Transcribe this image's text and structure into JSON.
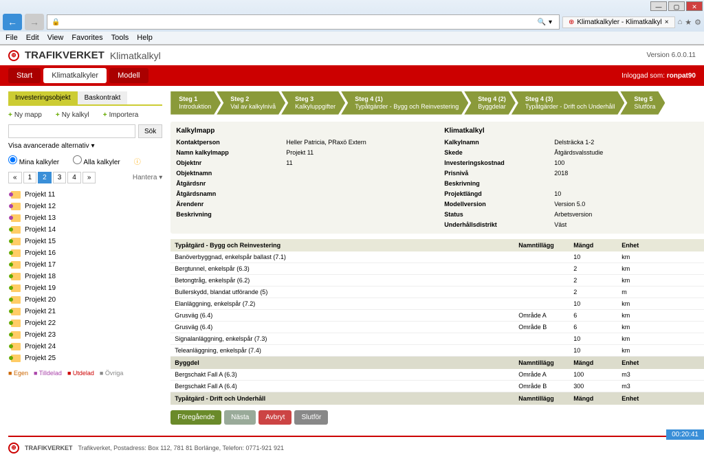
{
  "browser": {
    "tab_title": "Klimatkalkyler - Klimatkalkyl",
    "search_hint": "",
    "zoom_icon": "🔍"
  },
  "menus": [
    "File",
    "Edit",
    "View",
    "Favorites",
    "Tools",
    "Help"
  ],
  "header": {
    "brand": "TRAFIKVERKET",
    "app": "Klimatkalkyl",
    "version": "Version 6.0.0.11",
    "login_prefix": "Inloggad som:",
    "login_user": "ronpat90"
  },
  "main_tabs": [
    {
      "label": "Start",
      "active": false
    },
    {
      "label": "Klimatkalkyler",
      "active": true
    },
    {
      "label": "Modell",
      "active": false
    }
  ],
  "sub_tabs": [
    {
      "label": "Investeringsobjekt",
      "active": true
    },
    {
      "label": "Baskontrakt",
      "active": false
    }
  ],
  "toolbar": {
    "new_folder": "Ny mapp",
    "new_calc": "Ny kalkyl",
    "import": "Importera"
  },
  "search": {
    "placeholder": "",
    "btn": "Sök",
    "advanced": "Visa avancerade alternativ"
  },
  "radios": {
    "mine": "Mina kalkyler",
    "all": "Alla kalkyler"
  },
  "pager": {
    "pages": [
      "«",
      "1",
      "2",
      "3",
      "4",
      "»"
    ],
    "active": "2",
    "hantera": "Hantera"
  },
  "projects": [
    {
      "name": "Projekt 11",
      "color": "purple"
    },
    {
      "name": "Projekt 12",
      "color": "purple"
    },
    {
      "name": "Projekt 13",
      "color": "purple"
    },
    {
      "name": "Projekt 14",
      "color": "green"
    },
    {
      "name": "Projekt 15",
      "color": "green"
    },
    {
      "name": "Projekt 16",
      "color": "green"
    },
    {
      "name": "Projekt 17",
      "color": "green"
    },
    {
      "name": "Projekt 18",
      "color": "green"
    },
    {
      "name": "Projekt 19",
      "color": "green"
    },
    {
      "name": "Projekt 20",
      "color": "green"
    },
    {
      "name": "Projekt 21",
      "color": "green"
    },
    {
      "name": "Projekt 22",
      "color": "green"
    },
    {
      "name": "Projekt 23",
      "color": "green"
    },
    {
      "name": "Projekt 24",
      "color": "green"
    },
    {
      "name": "Projekt 25",
      "color": "green"
    }
  ],
  "legend": {
    "egen": "Egen",
    "tilldelad": "Tilldelad",
    "utdelad": "Utdelad",
    "ovriga": "Övriga"
  },
  "steps": [
    {
      "t": "Steg 1",
      "s": "Introduktion"
    },
    {
      "t": "Steg 2",
      "s": "Val av kalkylnivå"
    },
    {
      "t": "Steg 3",
      "s": "Kalkyluppgifter"
    },
    {
      "t": "Steg 4 (1)",
      "s": "Typåtgärder - Bygg och Reinvestering"
    },
    {
      "t": "Steg 4 (2)",
      "s": "Byggdelar"
    },
    {
      "t": "Steg 4 (3)",
      "s": "Typåtgärder - Drift och Underhåll"
    },
    {
      "t": "Steg 5",
      "s": "Slutföra"
    }
  ],
  "info": {
    "h1": "Kalkylmapp",
    "h2": "Klimatkalkyl",
    "left_labels": [
      "Kontaktperson",
      "Namn kalkylmapp",
      "Objektnr",
      "Objektnamn",
      "Åtgärdsnr",
      "Åtgärdsnamn",
      "Ärendenr",
      "Beskrivning"
    ],
    "left_vals": [
      "Heller Patricia, PRaxö Extern",
      "Projekt 11",
      "11",
      "",
      "",
      "",
      "",
      ""
    ],
    "right_labels": [
      "Kalkylnamn",
      "Skede",
      "Investeringskostnad",
      "Prisnivå",
      "Beskrivning",
      "Projektlängd",
      "Modellversion",
      "Status",
      "Underhållsdistrikt"
    ],
    "right_vals": [
      "Delsträcka 1-2",
      "Åtgärdsvalsstudie",
      "100",
      "2018",
      "",
      "10",
      "Version 5.0",
      "Arbetsversion",
      "Väst"
    ]
  },
  "table": {
    "sections": [
      {
        "title": "Typåtgärd - Bygg och Reinvestering",
        "cols": [
          "Namntillägg",
          "Mängd",
          "Enhet"
        ],
        "rows": [
          {
            "name": "Banöverbyggnad, enkelspår ballast (7.1)",
            "tag": "",
            "qty": "10",
            "unit": "km"
          },
          {
            "name": "Bergtunnel, enkelspår (6.3)",
            "tag": "",
            "qty": "2",
            "unit": "km"
          },
          {
            "name": "Betongtråg, enkelspår (6.2)",
            "tag": "",
            "qty": "2",
            "unit": "km"
          },
          {
            "name": "Bullerskydd, blandat utförande (5)",
            "tag": "",
            "qty": "2",
            "unit": "m"
          },
          {
            "name": "Elanläggning, enkelspår (7.2)",
            "tag": "",
            "qty": "10",
            "unit": "km"
          },
          {
            "name": "Grusväg (6.4)",
            "tag": "Område A",
            "qty": "6",
            "unit": "km"
          },
          {
            "name": "Grusväg (6.4)",
            "tag": "Område B",
            "qty": "6",
            "unit": "km"
          },
          {
            "name": "Signalanläggning, enkelspår (7.3)",
            "tag": "",
            "qty": "10",
            "unit": "km"
          },
          {
            "name": "Teleanläggning, enkelspår (7.4)",
            "tag": "",
            "qty": "10",
            "unit": "km"
          }
        ]
      },
      {
        "title": "Byggdel",
        "cols": [
          "Namntillägg",
          "Mängd",
          "Enhet"
        ],
        "rows": [
          {
            "name": "Bergschakt Fall A (6.3)",
            "tag": "Område A",
            "qty": "100",
            "unit": "m3"
          },
          {
            "name": "Bergschakt Fall A (6.4)",
            "tag": "Område B",
            "qty": "300",
            "unit": "m3"
          }
        ]
      },
      {
        "title": "Typåtgärd - Drift och Underhåll",
        "cols": [
          "Namntillägg",
          "Mängd",
          "Enhet"
        ],
        "rows": []
      }
    ]
  },
  "actions": {
    "prev": "Föregående",
    "next": "Nästa",
    "cancel": "Avbryt",
    "finish": "Slutför"
  },
  "footer": {
    "brand": "TRAFIKVERKET",
    "text": "Trafikverket, Postadress: Box 112, 781 81 Borlänge, Telefon: 0771-921 921"
  },
  "status": "00:20:41"
}
